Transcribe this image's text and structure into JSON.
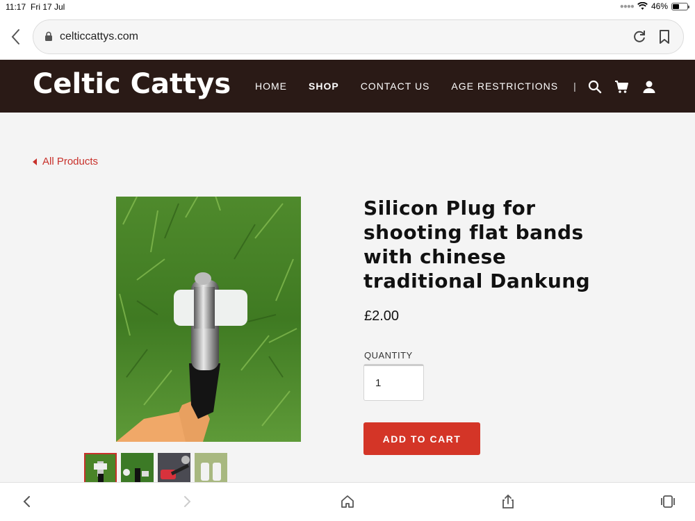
{
  "status": {
    "time": "11:17",
    "date": "Fri 17 Jul",
    "battery": "46%",
    "battery_level": 0.46
  },
  "browser": {
    "url": "celticcattys.com"
  },
  "site": {
    "logo": "Celtic Cattys",
    "nav": [
      "HOME",
      "SHOP",
      "CONTACT US",
      "AGE RESTRICTIONS"
    ],
    "nav_separator": "|",
    "active_nav": "SHOP"
  },
  "product": {
    "back_link": "All Products",
    "title": "Silicon Plug for shooting flat bands with chinese traditional Dankung",
    "price": "£2.00",
    "quantity_label": "QUANTITY",
    "quantity_value": "1",
    "add_to_cart": "ADD TO CART"
  },
  "colors": {
    "header_bg": "#2a1a16",
    "accent": "#d43527",
    "link": "#c8312b"
  }
}
